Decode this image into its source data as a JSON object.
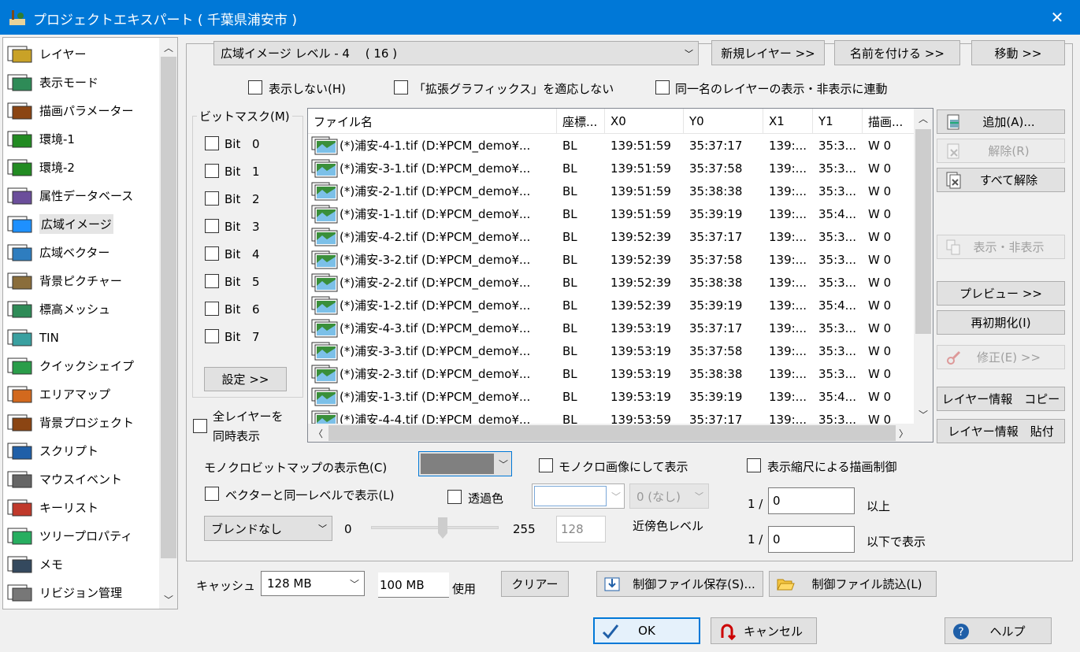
{
  "window": {
    "title": "プロジェクトエキスパート ( 千葉県浦安市 )"
  },
  "sidebar": {
    "items": [
      {
        "label": "レイヤー",
        "icon": "layers-icon"
      },
      {
        "label": "表示モード",
        "icon": "display-mode-icon"
      },
      {
        "label": "描画パラメーター",
        "icon": "draw-params-icon"
      },
      {
        "label": "環境-1",
        "icon": "environment-icon"
      },
      {
        "label": "環境-2",
        "icon": "environment-icon"
      },
      {
        "label": "属性データベース",
        "icon": "attribute-db-icon"
      },
      {
        "label": "広域イメージ",
        "icon": "wide-image-icon",
        "selected": true
      },
      {
        "label": "広域ベクター",
        "icon": "wide-vector-icon"
      },
      {
        "label": "背景ピクチャー",
        "icon": "background-picture-icon"
      },
      {
        "label": "標高メッシュ",
        "icon": "elevation-mesh-icon"
      },
      {
        "label": "TIN",
        "icon": "tin-icon"
      },
      {
        "label": "クイックシェイプ",
        "icon": "quick-shape-icon"
      },
      {
        "label": "エリアマップ",
        "icon": "area-map-icon"
      },
      {
        "label": "背景プロジェクト",
        "icon": "background-project-icon"
      },
      {
        "label": "スクリプト",
        "icon": "script-icon"
      },
      {
        "label": "マウスイベント",
        "icon": "mouse-icon"
      },
      {
        "label": "キーリスト",
        "icon": "key-list-icon"
      },
      {
        "label": "ツリープロパティ",
        "icon": "tree-property-icon"
      },
      {
        "label": "メモ",
        "icon": "memo-icon"
      },
      {
        "label": "リビジョン管理",
        "icon": "revision-icon"
      }
    ]
  },
  "top": {
    "level_select": "広域イメージ レベル - 4　 ( 16 )",
    "new_layer": "新規レイヤー >>",
    "rename": "名前を付ける >>",
    "move": "移動 >>"
  },
  "options": {
    "hide": "表示しない(H)",
    "no_ext_graphics": "「拡張グラフィックス」を適応しない",
    "link_same_name": "同一名のレイヤーの表示・非表示に連動"
  },
  "bitmask": {
    "title": "ビットマスク(M)",
    "bits": [
      {
        "label": "Bit",
        "num": "0"
      },
      {
        "label": "Bit",
        "num": "1"
      },
      {
        "label": "Bit",
        "num": "2"
      },
      {
        "label": "Bit",
        "num": "3"
      },
      {
        "label": "Bit",
        "num": "4"
      },
      {
        "label": "Bit",
        "num": "5"
      },
      {
        "label": "Bit",
        "num": "6"
      },
      {
        "label": "Bit",
        "num": "7"
      }
    ],
    "settings": "設定 >>",
    "all_layers_line1": "全レイヤーを",
    "all_layers_line2": "同時表示"
  },
  "filelist": {
    "columns": [
      "ファイル名",
      "座標...",
      "X0",
      "Y0",
      "X1",
      "Y1",
      "描画..."
    ],
    "rows": [
      [
        "(*)浦安-4-1.tif (D:¥PCM_demo¥...",
        "BL",
        "139:51:59",
        "35:37:17",
        "139:...",
        "35:3...",
        "W 0"
      ],
      [
        "(*)浦安-3-1.tif (D:¥PCM_demo¥...",
        "BL",
        "139:51:59",
        "35:37:58",
        "139:...",
        "35:3...",
        "W 0"
      ],
      [
        "(*)浦安-2-1.tif (D:¥PCM_demo¥...",
        "BL",
        "139:51:59",
        "35:38:38",
        "139:...",
        "35:3...",
        "W 0"
      ],
      [
        "(*)浦安-1-1.tif (D:¥PCM_demo¥...",
        "BL",
        "139:51:59",
        "35:39:19",
        "139:...",
        "35:4...",
        "W 0"
      ],
      [
        "(*)浦安-4-2.tif (D:¥PCM_demo¥...",
        "BL",
        "139:52:39",
        "35:37:17",
        "139:...",
        "35:3...",
        "W 0"
      ],
      [
        "(*)浦安-3-2.tif (D:¥PCM_demo¥...",
        "BL",
        "139:52:39",
        "35:37:58",
        "139:...",
        "35:3...",
        "W 0"
      ],
      [
        "(*)浦安-2-2.tif (D:¥PCM_demo¥...",
        "BL",
        "139:52:39",
        "35:38:38",
        "139:...",
        "35:3...",
        "W 0"
      ],
      [
        "(*)浦安-1-2.tif (D:¥PCM_demo¥...",
        "BL",
        "139:52:39",
        "35:39:19",
        "139:...",
        "35:4...",
        "W 0"
      ],
      [
        "(*)浦安-4-3.tif (D:¥PCM_demo¥...",
        "BL",
        "139:53:19",
        "35:37:17",
        "139:...",
        "35:3...",
        "W 0"
      ],
      [
        "(*)浦安-3-3.tif (D:¥PCM_demo¥...",
        "BL",
        "139:53:19",
        "35:37:58",
        "139:...",
        "35:3...",
        "W 0"
      ],
      [
        "(*)浦安-2-3.tif (D:¥PCM_demo¥...",
        "BL",
        "139:53:19",
        "35:38:38",
        "139:...",
        "35:3...",
        "W 0"
      ],
      [
        "(*)浦安-1-3.tif (D:¥PCM_demo¥...",
        "BL",
        "139:53:19",
        "35:39:19",
        "139:...",
        "35:4...",
        "W 0"
      ],
      [
        "(*)浦安-4-4.tif (D:¥PCM_demo¥...",
        "BL",
        "139:53:59",
        "35:37:17",
        "139:...",
        "35:3...",
        "W 0"
      ]
    ]
  },
  "right_buttons": {
    "add": "追加(A)...",
    "remove": "解除(R)",
    "remove_all": "すべて解除",
    "show_hide": "表示・非表示",
    "preview": "プレビュー >>",
    "reinit": "再初期化(I)",
    "modify": "修正(E) >>",
    "copy_info": "レイヤー情報　コピー",
    "paste_info": "レイヤー情報　貼付"
  },
  "lower": {
    "mono_color_label": "モノクロビットマップの表示色(C)",
    "mono_color_value": "#808080",
    "mono_image": "モノクロ画像にして表示",
    "scale_control": "表示縮尺による描画制御",
    "same_level_vector": "ベクターと同一レベルで表示(L)",
    "transparent": "透過色",
    "near_color_select": "0 (なし)",
    "near_color_label": "近傍色レベル",
    "blend_select": "ブレンドなし",
    "slider_min": "0",
    "slider_max": "255",
    "slider_value": "128",
    "slider_fraction": 0.5,
    "scale_prefix1": "1 /",
    "scale_value1": "0",
    "scale_suffix1": "以上",
    "scale_prefix2": "1 /",
    "scale_value2": "0",
    "scale_suffix2": "以下で表示"
  },
  "cache": {
    "label": "キャッシュ",
    "size": "128 MB",
    "used": "100 MB",
    "used_label": "使用",
    "clear": "クリアー",
    "save_ctrl": "制御ファイル保存(S)...",
    "load_ctrl": "制御ファイル読込(L)"
  },
  "footer": {
    "ok": "OK",
    "cancel": "キャンセル",
    "help": "ヘルプ"
  }
}
